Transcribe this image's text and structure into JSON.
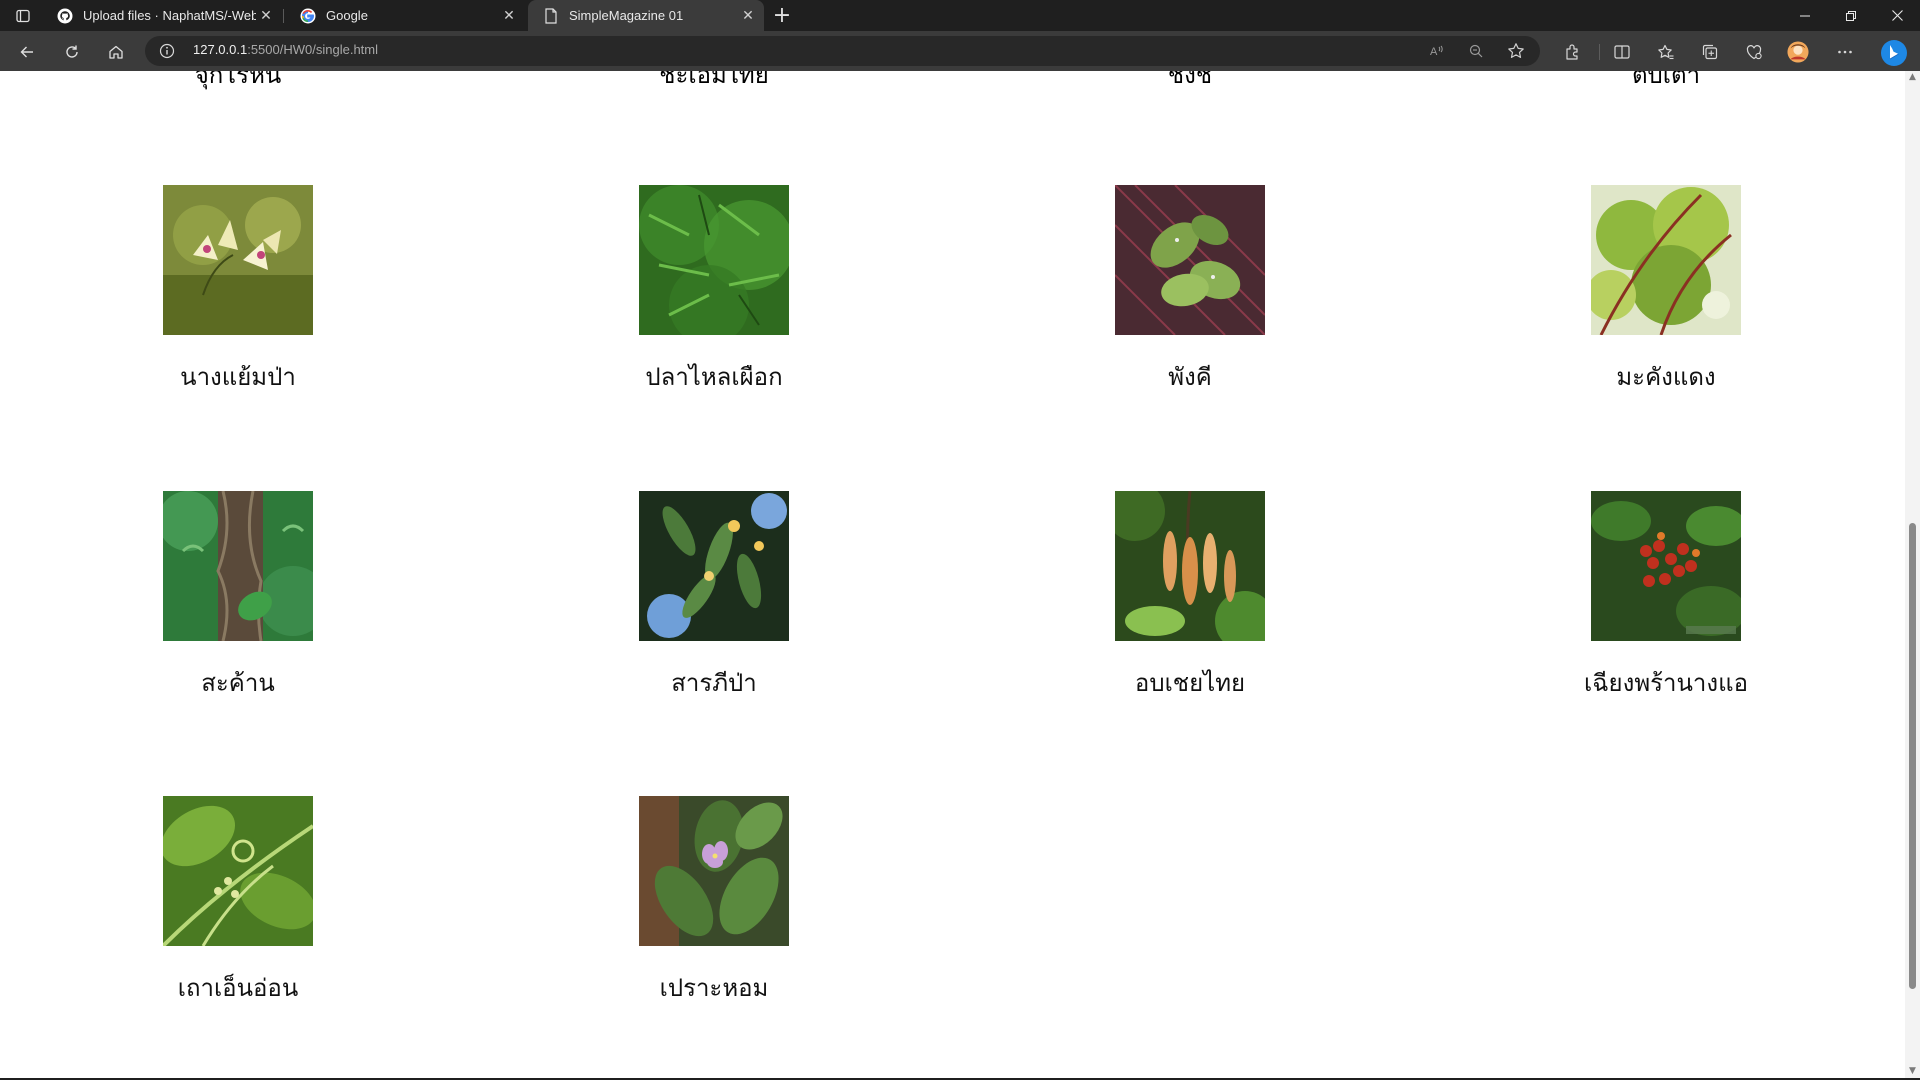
{
  "browser": {
    "tabs": [
      {
        "title": "Upload files · NaphatMS/-Webd",
        "icon": "github-icon",
        "active": false
      },
      {
        "title": "Google",
        "icon": "google-icon",
        "active": false
      },
      {
        "title": "SimpleMagazine 01",
        "icon": "page-icon",
        "active": true
      }
    ],
    "address": {
      "host": "127.0.0.1",
      "rest": ":5500/HW0/single.html"
    }
  },
  "page": {
    "top_cut_labels": [
      "จุกโรหินี",
      "ชะเอมไทย",
      "ชิงชี่",
      "ตับเต่า"
    ],
    "plants": [
      {
        "name": "นางแย้มป่า"
      },
      {
        "name": "ปลาไหลเผือก"
      },
      {
        "name": "พังคี"
      },
      {
        "name": "มะคังแดง"
      },
      {
        "name": "สะค้าน"
      },
      {
        "name": "สารภีป่า"
      },
      {
        "name": "อบเชยไทย"
      },
      {
        "name": "เฉียงพร้านางแอ"
      },
      {
        "name": "เถาเอ็นอ่อน"
      },
      {
        "name": "เปราะหอม"
      }
    ]
  },
  "colors": {
    "tabbar": "#1f1f1f",
    "toolbar": "#3b3b3b",
    "accent_bing": "#1e88e5"
  }
}
